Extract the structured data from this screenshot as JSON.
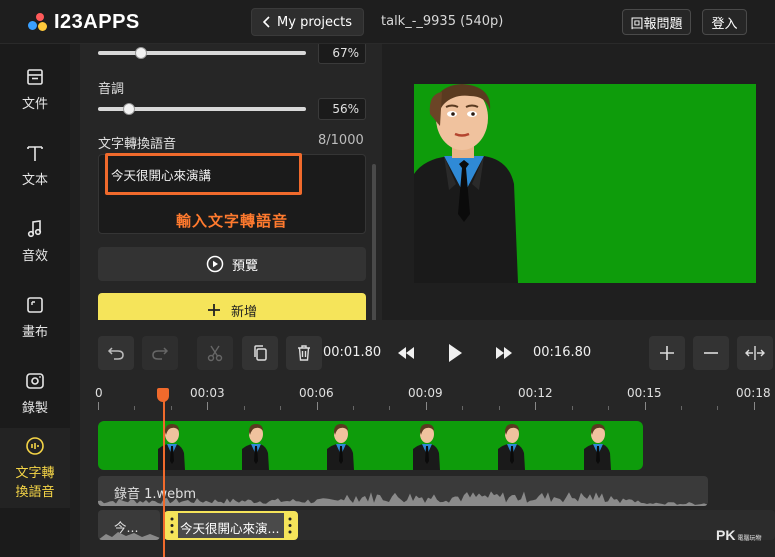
{
  "app": {
    "logo_text": "I23APPS",
    "file_name": "talk_-_9935 (540p)"
  },
  "header": {
    "projects_label": "My projects",
    "report_label": "回報問題",
    "login_label": "登入"
  },
  "sidebar": {
    "items": [
      {
        "label": "文件",
        "icon": "file-icon"
      },
      {
        "label": "文本",
        "icon": "text-icon"
      },
      {
        "label": "音效",
        "icon": "music-icon"
      },
      {
        "label": "畫布",
        "icon": "canvas-icon"
      },
      {
        "label": "錄製",
        "icon": "record-icon"
      },
      {
        "label_line1": "文字轉",
        "label_line2": "換語音",
        "icon": "tts-icon",
        "active": true
      }
    ]
  },
  "panel": {
    "speed_value": 0.67,
    "speed_percent": "67%",
    "pitch_label": "音調",
    "pitch_value": 0.56,
    "pitch_percent": "56%",
    "tts_label": "文字轉換語音",
    "tts_counter": "8/1000",
    "tts_text": "今天很開心來演講",
    "annotation": "輸入文字轉語音",
    "preview_label": "預覽",
    "add_label": "新增"
  },
  "timeline": {
    "current_time": "00:01.80",
    "total_time": "00:16.80",
    "ruler": [
      "0",
      "00:03",
      "00:06",
      "00:09",
      "00:12",
      "00:15",
      "00:18"
    ],
    "audio_track_label": "錄音 1.webm",
    "tts_clip1_label": "今...",
    "tts_clip2_label": "今天很開心來演..."
  },
  "watermark": {
    "text": "PK",
    "sub": "電腦玩物"
  },
  "colors": {
    "accent": "#f5e45a",
    "annotation": "#f06a2c",
    "green_screen": "#0e9c0b"
  }
}
